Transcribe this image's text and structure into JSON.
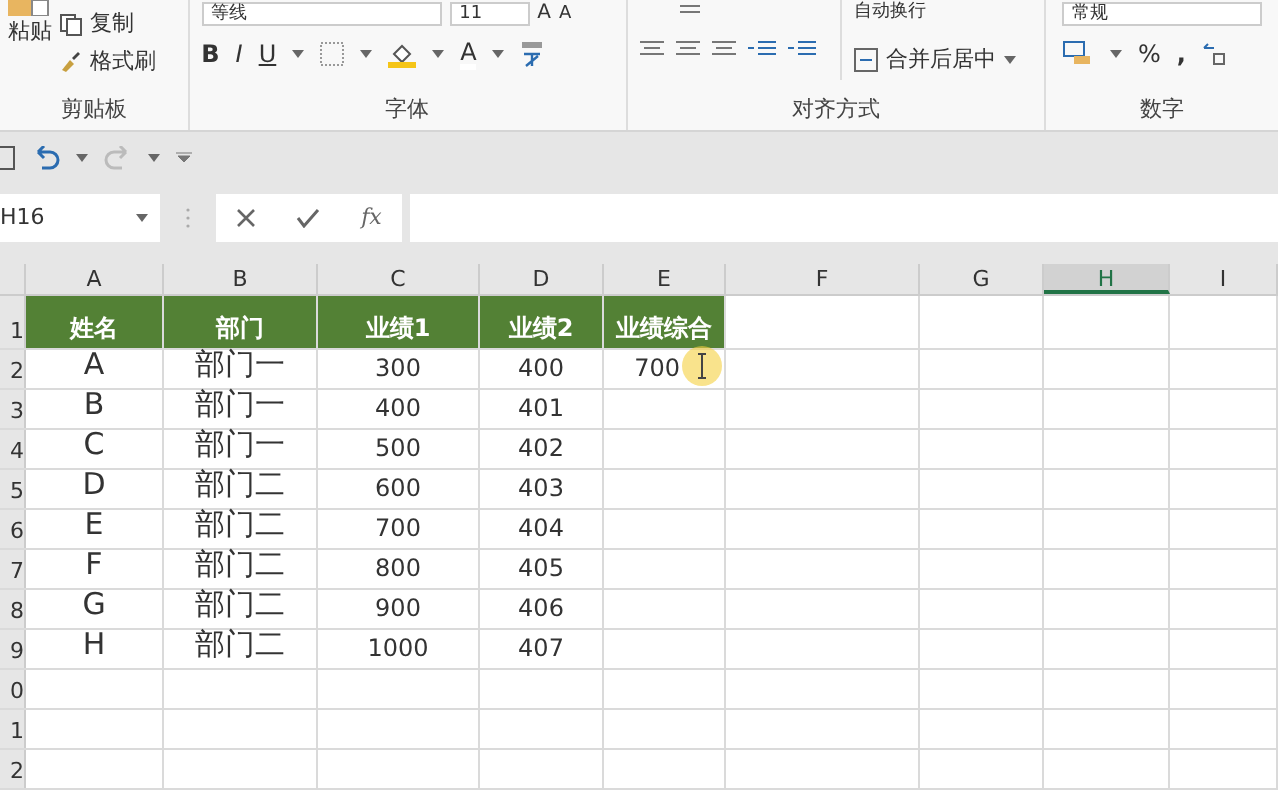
{
  "ribbon": {
    "clipboard": {
      "label": "剪贴板",
      "paste": "粘贴",
      "copy": "复制",
      "format_painter": "格式刷"
    },
    "font": {
      "label": "字体",
      "font_name": "等线",
      "font_size": "11",
      "grow": "A",
      "shrink": "A",
      "bold": "B",
      "italic": "I",
      "underline": "U",
      "font_color": "A"
    },
    "alignment": {
      "label": "对齐方式",
      "wrap": "自动换行",
      "merge": "合并后居中"
    },
    "number": {
      "label": "数字",
      "format": "常规",
      "percent": "%",
      "comma": ","
    }
  },
  "formula_bar": {
    "name_box": "H16",
    "function": "fx"
  },
  "sheet": {
    "columns": [
      {
        "label": "A",
        "selected": false
      },
      {
        "label": "B",
        "selected": false
      },
      {
        "label": "C",
        "selected": false
      },
      {
        "label": "D",
        "selected": false
      },
      {
        "label": "E",
        "selected": false
      },
      {
        "label": "F",
        "selected": false
      },
      {
        "label": "G",
        "selected": false
      },
      {
        "label": "H",
        "selected": true
      },
      {
        "label": "I",
        "selected": false
      }
    ],
    "rows": [
      {
        "header": "1",
        "kind": "header",
        "cells": [
          "姓名",
          "部门",
          "业绩1",
          "业绩2",
          "业绩综合"
        ]
      },
      {
        "header": "2",
        "kind": "data",
        "cells": [
          "A",
          "部门一",
          "300",
          "400",
          "700"
        ]
      },
      {
        "header": "3",
        "kind": "data",
        "cells": [
          "B",
          "部门一",
          "400",
          "401"
        ]
      },
      {
        "header": "4",
        "kind": "data",
        "cells": [
          "C",
          "部门一",
          "500",
          "402"
        ]
      },
      {
        "header": "5",
        "kind": "data",
        "cells": [
          "D",
          "部门二",
          "600",
          "403"
        ]
      },
      {
        "header": "6",
        "kind": "data",
        "cells": [
          "E",
          "部门二",
          "700",
          "404"
        ]
      },
      {
        "header": "7",
        "kind": "data",
        "cells": [
          "F",
          "部门二",
          "800",
          "405"
        ]
      },
      {
        "header": "8",
        "kind": "data",
        "cells": [
          "G",
          "部门二",
          "900",
          "406"
        ]
      },
      {
        "header": "9",
        "kind": "data",
        "cells": [
          "H",
          "部门二",
          "1000",
          "407"
        ]
      },
      {
        "header": "0",
        "kind": "data",
        "cells": []
      },
      {
        "header": "1",
        "kind": "data",
        "cells": []
      },
      {
        "header": "2",
        "kind": "data",
        "cells": []
      }
    ]
  }
}
